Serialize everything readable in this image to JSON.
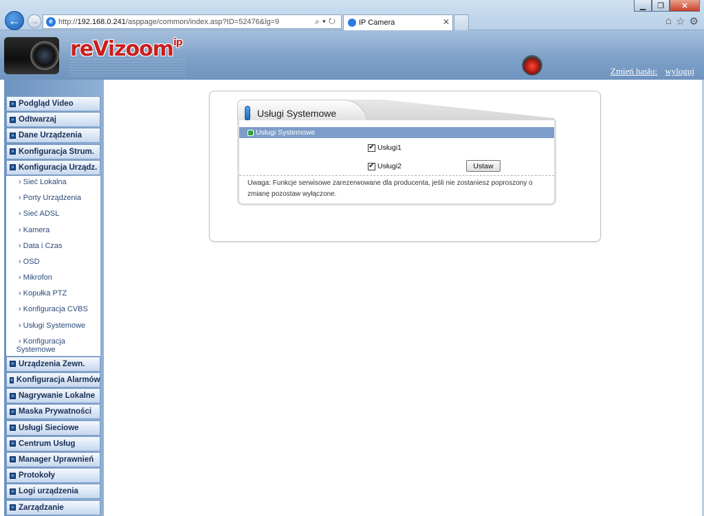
{
  "browser": {
    "url_prefix": "http://",
    "url_host": "192.168.0.241",
    "url_path": "/asppage/common/index.asp?ID=52476&lg=9",
    "tab_title": "IP Camera"
  },
  "header": {
    "logo": "reVizoom",
    "logo_suffix": "ip",
    "change_password": "Zmień hasło:",
    "logout": "wyloguj"
  },
  "sidebar": {
    "top_items": [
      {
        "label": "Podgląd Video"
      },
      {
        "label": "Odtwarzaj"
      },
      {
        "label": "Dane Urządzenia"
      },
      {
        "label": "Konfiguracja Strum."
      },
      {
        "label": "Konfiguracja Urządz."
      }
    ],
    "sub_items": [
      {
        "label": "Sieć Lokalna"
      },
      {
        "label": "Porty Urządzenia"
      },
      {
        "label": "Sieć ADSL"
      },
      {
        "label": "Kamera"
      },
      {
        "label": "Data i Czas"
      },
      {
        "label": "OSD"
      },
      {
        "label": "Mikrofon"
      },
      {
        "label": "Kopułka PTZ"
      },
      {
        "label": "Konfiguracja CVBS"
      },
      {
        "label": "Usługi Systemowe"
      },
      {
        "label_line1": "Konfiguracja",
        "label_line2": "Systemowe"
      }
    ],
    "bottom_items": [
      {
        "label": "Urządzenia Zewn."
      },
      {
        "label": "Konfiguracja Alarmów"
      },
      {
        "label": "Nagrywanie Lokalne"
      },
      {
        "label": "Maska Prywatności"
      },
      {
        "label": "Usługi Sieciowe"
      },
      {
        "label": "Centrum Usług"
      },
      {
        "label": "Manager Uprawnień"
      },
      {
        "label": "Protokoły"
      },
      {
        "label": "Logi urządzenia"
      },
      {
        "label": "Zarządzanie"
      }
    ]
  },
  "panel": {
    "title": "Usługi Systemowe",
    "section_title": "Usługi Systemowe",
    "checkbox1": {
      "label": "Usługi1",
      "checked": true
    },
    "checkbox2": {
      "label": "Usługi2",
      "checked": true
    },
    "set_button": "Ustaw",
    "note": "Uwaga: Funkcje serwisowe zarezerwowane dla producenta, jeśli nie zostaniesz poproszony o zmianę pozostaw wyłączone."
  }
}
